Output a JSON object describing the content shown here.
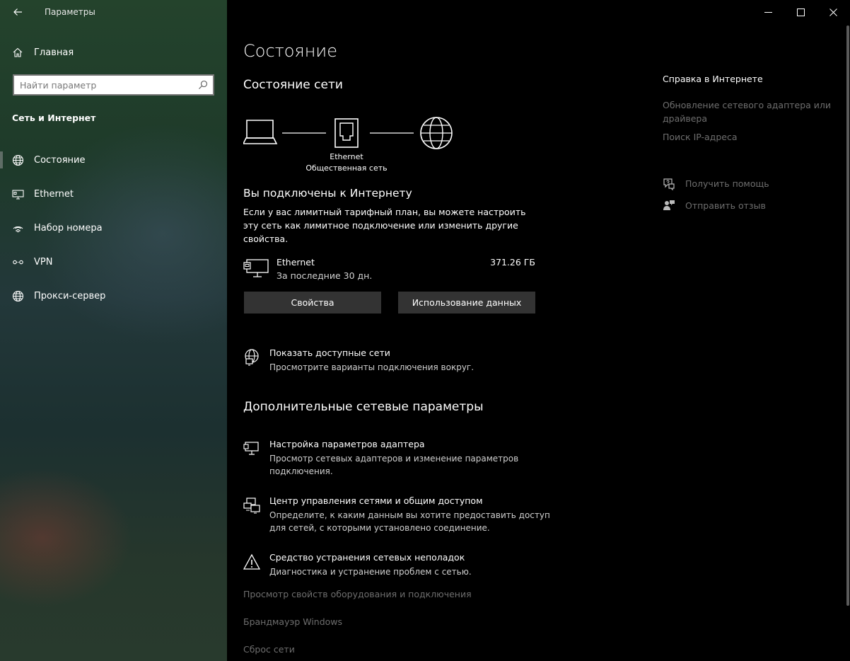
{
  "window": {
    "title": "Параметры"
  },
  "sidebar": {
    "home_label": "Главная",
    "search_placeholder": "Найти параметр",
    "section_title": "Сеть и Интернет",
    "items": [
      {
        "label": "Состояние",
        "icon": "globe-icon",
        "active": true
      },
      {
        "label": "Ethernet",
        "icon": "ethernet-icon",
        "active": false
      },
      {
        "label": "Набор номера",
        "icon": "dialup-icon",
        "active": false
      },
      {
        "label": "VPN",
        "icon": "vpn-icon",
        "active": false
      },
      {
        "label": "Прокси-сервер",
        "icon": "globe-icon",
        "active": false
      }
    ]
  },
  "main": {
    "page_title": "Состояние",
    "network_status_title": "Состояние сети",
    "diagram": {
      "adapter_label": "Ethernet",
      "network_label": "Общественная сеть"
    },
    "connected_title": "Вы подключены к Интернету",
    "connected_desc": "Если у вас лимитный тарифный план, вы можете настроить эту сеть как лимитное подключение или изменить другие свойства.",
    "ethernet": {
      "name": "Ethernet",
      "period": "За последние 30 дн.",
      "usage": "371.26 ГБ"
    },
    "buttons": {
      "properties": "Свойства",
      "data_usage": "Использование данных"
    },
    "show_networks": {
      "title": "Показать доступные сети",
      "desc": "Просмотрите варианты подключения вокруг."
    },
    "advanced_title": "Дополнительные сетевые параметры",
    "advanced_items": [
      {
        "title": "Настройка параметров адаптера",
        "desc": "Просмотр сетевых адаптеров и изменение параметров подключения."
      },
      {
        "title": "Центр управления сетями и общим доступом",
        "desc": "Определите, к каким данным вы хотите предоставить доступ для сетей, с которыми установлено соединение."
      },
      {
        "title": "Средство устранения сетевых неполадок",
        "desc": "Диагностика и устранение проблем с сетью."
      }
    ],
    "more_links": [
      "Просмотр свойств оборудования и подключения",
      "Брандмауэр Windows",
      "Сброс сети"
    ]
  },
  "right": {
    "help_title": "Справка в Интернете",
    "help_links": [
      "Обновление сетевого адаптера или драйвера",
      "Поиск IP-адреса"
    ],
    "get_help": "Получить помощь",
    "feedback": "Отправить отзыв"
  }
}
